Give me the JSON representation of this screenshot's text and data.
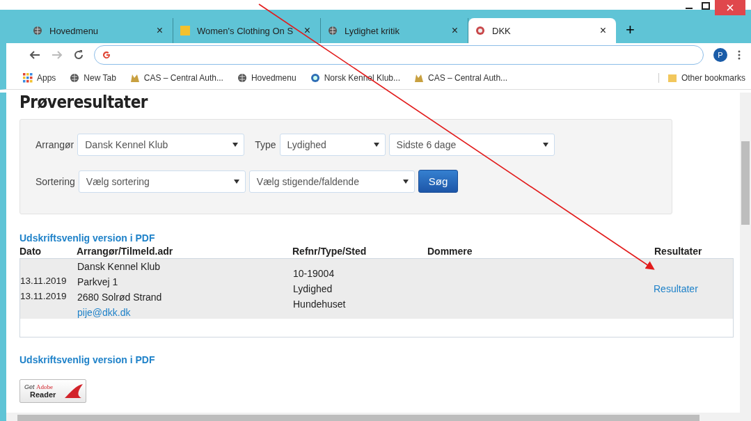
{
  "browser": {
    "tabs": [
      {
        "title": "Hovedmenu",
        "kind": "globe",
        "selected": false
      },
      {
        "title": "Women's Clothing On S",
        "kind": "letter",
        "selected": false
      },
      {
        "title": "Lydighet kritik",
        "kind": "globe",
        "selected": false
      },
      {
        "title": "DKK",
        "kind": "badge",
        "selected": true
      }
    ],
    "new_tab": "+",
    "close": "×",
    "address": {
      "profile": "P"
    },
    "bookmarks": [
      {
        "label": "Apps",
        "kind": "apps"
      },
      {
        "label": "New Tab",
        "kind": "globe"
      },
      {
        "label": "CAS – Central Auth...",
        "kind": "dog"
      },
      {
        "label": "Hovedmenu",
        "kind": "globe"
      },
      {
        "label": "Norsk Kennel Klub...",
        "kind": "badge"
      },
      {
        "label": "CAS – Central Auth...",
        "kind": "dog"
      }
    ],
    "other_bookmarks": "Other bookmarks"
  },
  "page": {
    "title": "Prøveresultater",
    "filters": {
      "row_1": [
        {
          "label": "Arrangør",
          "value": "Dansk Kennel Klub"
        },
        {
          "label": "Type",
          "value": "Lydighed"
        },
        {
          "value": "Sidste 6 dage"
        }
      ],
      "row_2": [
        {
          "label": "Sortering",
          "value": "Vælg sortering"
        },
        {
          "value": "Vælg stigende/faldende"
        }
      ],
      "search_button": "Søg"
    },
    "pdf_link_top": "Udskriftsvenlig version i PDF",
    "table": {
      "columns": [
        "Dato",
        "Arrangør/Tilmeld.adr",
        "Refnr/Type/Sted",
        "Dommere",
        "Resultater"
      ],
      "rows": [
        {
          "dates": [
            "13.11.2019",
            "13.11.2019"
          ],
          "organizer": [
            "Dansk Kennel Klub",
            "Parkvej 1",
            "2680  Solrød Strand"
          ],
          "email": "pije@dkk.dk",
          "ref": [
            "10-19004",
            "Lydighed",
            "Hundehuset"
          ],
          "result_link": "Resultater"
        }
      ]
    },
    "pdf_link_bottom": "Udskriftsvenlig version i PDF",
    "adobe_badge": {
      "get": "Get",
      "brand": "Adobe",
      "product": "Reader"
    }
  }
}
